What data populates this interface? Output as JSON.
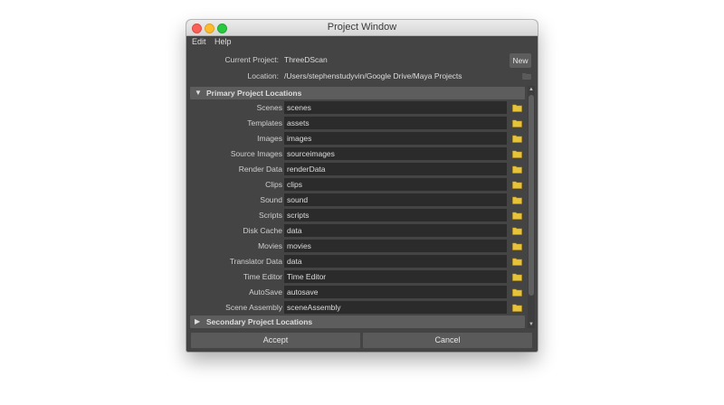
{
  "window": {
    "title": "Project Window",
    "buttons": [
      "close",
      "minimize",
      "zoom"
    ]
  },
  "menu": {
    "items": [
      "Edit",
      "Help"
    ]
  },
  "project": {
    "current_label": "Current Project:",
    "current_value": "ThreeDScan",
    "new_button": "New",
    "location_label": "Location:",
    "location_value": "/Users/stephenstudyvin/Google Drive/Maya Projects",
    "folder_icon": "folder-icon"
  },
  "primary": {
    "header": "Primary Project Locations",
    "expanded": true,
    "rows": [
      {
        "label": "Scenes",
        "value": "scenes"
      },
      {
        "label": "Templates",
        "value": "assets"
      },
      {
        "label": "Images",
        "value": "images"
      },
      {
        "label": "Source Images",
        "value": "sourceimages"
      },
      {
        "label": "Render Data",
        "value": "renderData"
      },
      {
        "label": "Clips",
        "value": "clips"
      },
      {
        "label": "Sound",
        "value": "sound"
      },
      {
        "label": "Scripts",
        "value": "scripts"
      },
      {
        "label": "Disk Cache",
        "value": "data"
      },
      {
        "label": "Movies",
        "value": "movies"
      },
      {
        "label": "Translator Data",
        "value": "data"
      },
      {
        "label": "Time Editor",
        "value": "Time Editor"
      },
      {
        "label": "AutoSave",
        "value": "autosave"
      },
      {
        "label": "Scene Assembly",
        "value": "sceneAssembly"
      }
    ]
  },
  "secondary": {
    "header": "Secondary Project Locations",
    "expanded": false
  },
  "footer": {
    "accept": "Accept",
    "cancel": "Cancel"
  },
  "colors": {
    "window_bg": "#444444",
    "field_bg": "#2b2b2b",
    "header_bg": "#5d5d5d",
    "folder": "#e8c33a",
    "text": "#dddddd"
  }
}
